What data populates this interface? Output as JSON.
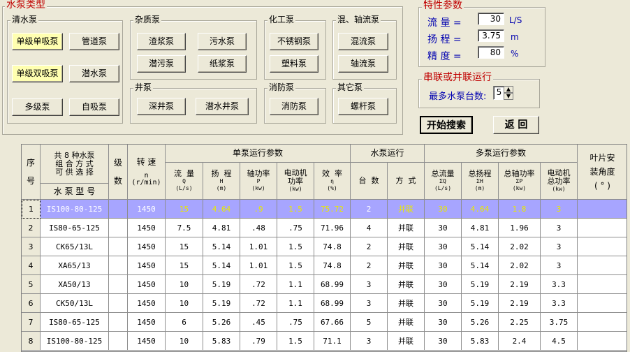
{
  "pump_type": {
    "title": "水泵类型",
    "clear_water": {
      "title": "清水泵",
      "buttons": [
        "单级单吸泵",
        "管道泵",
        "单级双吸泵",
        "潜水泵",
        "多级泵",
        "自吸泵"
      ]
    },
    "misc": {
      "title": "杂质泵",
      "buttons": [
        "渣浆泵",
        "污水泵",
        "潜污泵",
        "纸浆泵"
      ]
    },
    "well": {
      "title": "井泵",
      "buttons": [
        "深井泵",
        "潜水井泵"
      ]
    },
    "chemical": {
      "title": "化工泵",
      "buttons": [
        "不锈钢泵",
        "塑料泵"
      ]
    },
    "fire": {
      "title": "消防泵",
      "buttons": [
        "消防泵"
      ]
    },
    "mixed": {
      "title": "混、轴流泵",
      "buttons": [
        "混流泵",
        "轴流泵"
      ]
    },
    "other": {
      "title": "其它泵",
      "buttons": [
        "螺杆泵"
      ]
    }
  },
  "params": {
    "title": "特性参数",
    "flow": {
      "label": "流  量 =",
      "value": "30",
      "unit": "L/S"
    },
    "head": {
      "label": "扬  程 =",
      "value": "3.75",
      "unit": "m"
    },
    "precision": {
      "label": "精  度 =",
      "value": "80",
      "unit": "%"
    }
  },
  "series": {
    "title": "串联或并联运行",
    "label": "最多水泵台数:",
    "value": "5"
  },
  "actions": {
    "search": "开始搜索",
    "back": "返  回"
  },
  "table": {
    "h_seq": "序\n\n号",
    "h_avail": "共 8 种水泵\n组 合 方 式\n可 供 选 择",
    "h_model": "水 泵 型 号",
    "h_stage": "级\n\n数",
    "h_speed": "转  速",
    "h_speed_sym": "n",
    "h_speed_unit": "(r/min)",
    "h_single": "单泵运行参数",
    "h_run": "水泵运行",
    "h_multi": "多泵运行参数",
    "h_blade": "叶片安\n装角度\n( ° )",
    "single_cols": [
      {
        "name": "流  量",
        "sym": "Q",
        "unit": "(L/s)"
      },
      {
        "name": "扬  程",
        "sym": "H",
        "unit": "(m)"
      },
      {
        "name": "轴功率",
        "sym": "P",
        "unit": "(kw)"
      },
      {
        "name": "电动机\n功率",
        "sym": "",
        "unit": "(kw)"
      },
      {
        "name": "效  率",
        "sym": "η",
        "unit": "(%)"
      }
    ],
    "run_cols": [
      {
        "name": "台  数"
      },
      {
        "name": "方  式"
      }
    ],
    "multi_cols": [
      {
        "name": "总流量",
        "sym": "ΣQ",
        "unit": "(L/s)"
      },
      {
        "name": "总扬程",
        "sym": "ΣH",
        "unit": "(m)"
      },
      {
        "name": "总轴功率",
        "sym": "ΣP",
        "unit": "(kw)"
      },
      {
        "name": "电动机\n总功率",
        "sym": "",
        "unit": "(kw)"
      }
    ],
    "rows": [
      [
        "1",
        "IS100-80-125",
        "",
        "1450",
        "15",
        "4.64",
        ".9",
        "1.5",
        "75.72",
        "2",
        "并联",
        "30",
        "4.64",
        "1.8",
        "3",
        ""
      ],
      [
        "2",
        "IS80-65-125",
        "",
        "1450",
        "7.5",
        "4.81",
        ".48",
        ".75",
        "71.96",
        "4",
        "并联",
        "30",
        "4.81",
        "1.96",
        "3",
        ""
      ],
      [
        "3",
        "CK65/13L",
        "",
        "1450",
        "15",
        "5.14",
        "1.01",
        "1.5",
        "74.8",
        "2",
        "并联",
        "30",
        "5.14",
        "2.02",
        "3",
        ""
      ],
      [
        "4",
        "XA65/13",
        "",
        "1450",
        "15",
        "5.14",
        "1.01",
        "1.5",
        "74.8",
        "2",
        "并联",
        "30",
        "5.14",
        "2.02",
        "3",
        ""
      ],
      [
        "5",
        "XA50/13",
        "",
        "1450",
        "10",
        "5.19",
        ".72",
        "1.1",
        "68.99",
        "3",
        "并联",
        "30",
        "5.19",
        "2.19",
        "3.3",
        ""
      ],
      [
        "6",
        "CK50/13L",
        "",
        "1450",
        "10",
        "5.19",
        ".72",
        "1.1",
        "68.99",
        "3",
        "并联",
        "30",
        "5.19",
        "2.19",
        "3.3",
        ""
      ],
      [
        "7",
        "IS80-65-125",
        "",
        "1450",
        "6",
        "5.26",
        ".45",
        ".75",
        "67.66",
        "5",
        "并联",
        "30",
        "5.26",
        "2.25",
        "3.75",
        ""
      ],
      [
        "8",
        "IS100-80-125",
        "",
        "1450",
        "10",
        "5.83",
        ".79",
        "1.5",
        "71.1",
        "3",
        "并联",
        "30",
        "5.83",
        "2.4",
        "4.5",
        ""
      ]
    ]
  }
}
